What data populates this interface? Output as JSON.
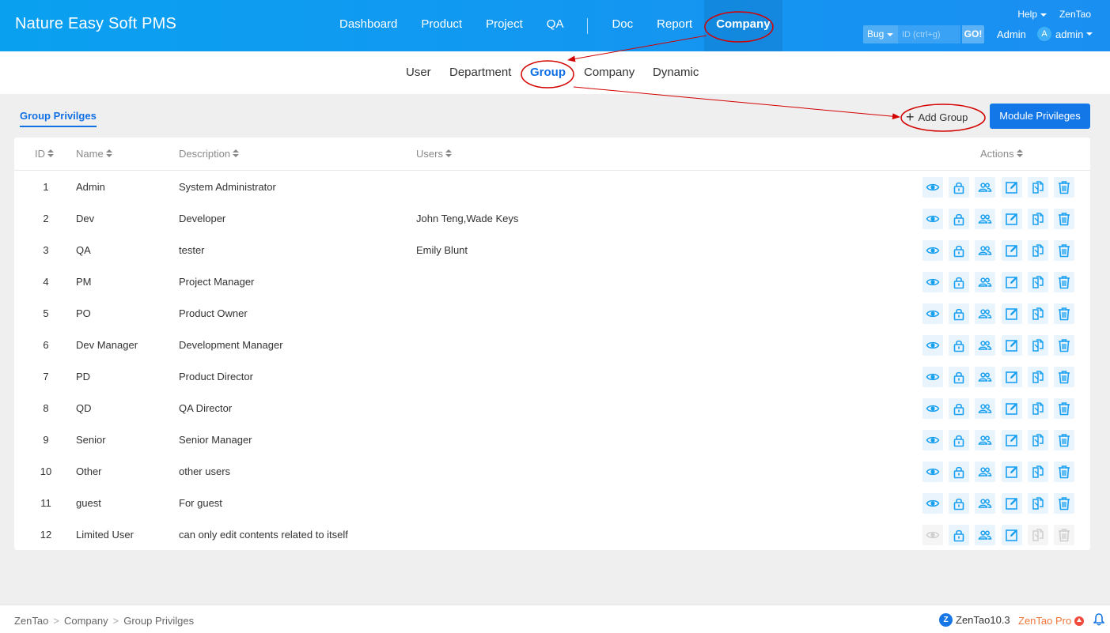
{
  "app": {
    "brand": "Nature Easy Soft PMS"
  },
  "main_nav": {
    "items": [
      {
        "label": "Dashboard"
      },
      {
        "label": "Product"
      },
      {
        "label": "Project"
      },
      {
        "label": "QA"
      },
      {
        "label": "Doc"
      },
      {
        "label": "Report"
      },
      {
        "label": "Company"
      }
    ],
    "active": "Company"
  },
  "top_right": {
    "help": "Help",
    "zentao": "ZenTao",
    "search": {
      "type": "Bug",
      "placeholder": "ID (ctrl+g)",
      "go": "GO!"
    },
    "admin_link": "Admin",
    "user": {
      "avatar_letter": "A",
      "name": "admin"
    }
  },
  "sub_nav": {
    "items": [
      {
        "label": "User"
      },
      {
        "label": "Department"
      },
      {
        "label": "Group"
      },
      {
        "label": "Company"
      },
      {
        "label": "Dynamic"
      }
    ],
    "active": "Group"
  },
  "toolbar": {
    "tab_title": "Group Privilges",
    "add_group": "Add Group",
    "module_privileges": "Module Privileges"
  },
  "table": {
    "headers": {
      "id": "ID",
      "name": "Name",
      "description": "Description",
      "users": "Users",
      "actions": "Actions"
    },
    "rows": [
      {
        "id": "1",
        "name": "Admin",
        "description": "System Administrator",
        "users": ""
      },
      {
        "id": "2",
        "name": "Dev",
        "description": "Developer",
        "users": "John Teng,Wade Keys"
      },
      {
        "id": "3",
        "name": "QA",
        "description": "tester",
        "users": "Emily Blunt"
      },
      {
        "id": "4",
        "name": "PM",
        "description": "Project Manager",
        "users": ""
      },
      {
        "id": "5",
        "name": "PO",
        "description": "Product Owner",
        "users": ""
      },
      {
        "id": "6",
        "name": "Dev Manager",
        "description": "Development Manager",
        "users": ""
      },
      {
        "id": "7",
        "name": "PD",
        "description": "Product Director",
        "users": ""
      },
      {
        "id": "8",
        "name": "QD",
        "description": "QA Director",
        "users": ""
      },
      {
        "id": "9",
        "name": "Senior",
        "description": "Senior Manager",
        "users": ""
      },
      {
        "id": "10",
        "name": "Other",
        "description": "other users",
        "users": ""
      },
      {
        "id": "11",
        "name": "guest",
        "description": "For guest",
        "users": ""
      },
      {
        "id": "12",
        "name": "Limited User",
        "description": "can only edit contents related to itself",
        "users": ""
      }
    ],
    "action_icons": [
      "eye-icon",
      "lock-icon",
      "users-icon",
      "edit-icon",
      "copy-icon",
      "trash-icon"
    ]
  },
  "footer": {
    "breadcrumb": [
      "ZenTao",
      "Company",
      "Group Privilges"
    ],
    "version": "ZenTao10.3",
    "pro": "ZenTao Pro"
  },
  "colors": {
    "header": "#1a8ff2",
    "accent": "#1170e4",
    "icon": "#1aa0f0",
    "annotation": "#d40000"
  }
}
